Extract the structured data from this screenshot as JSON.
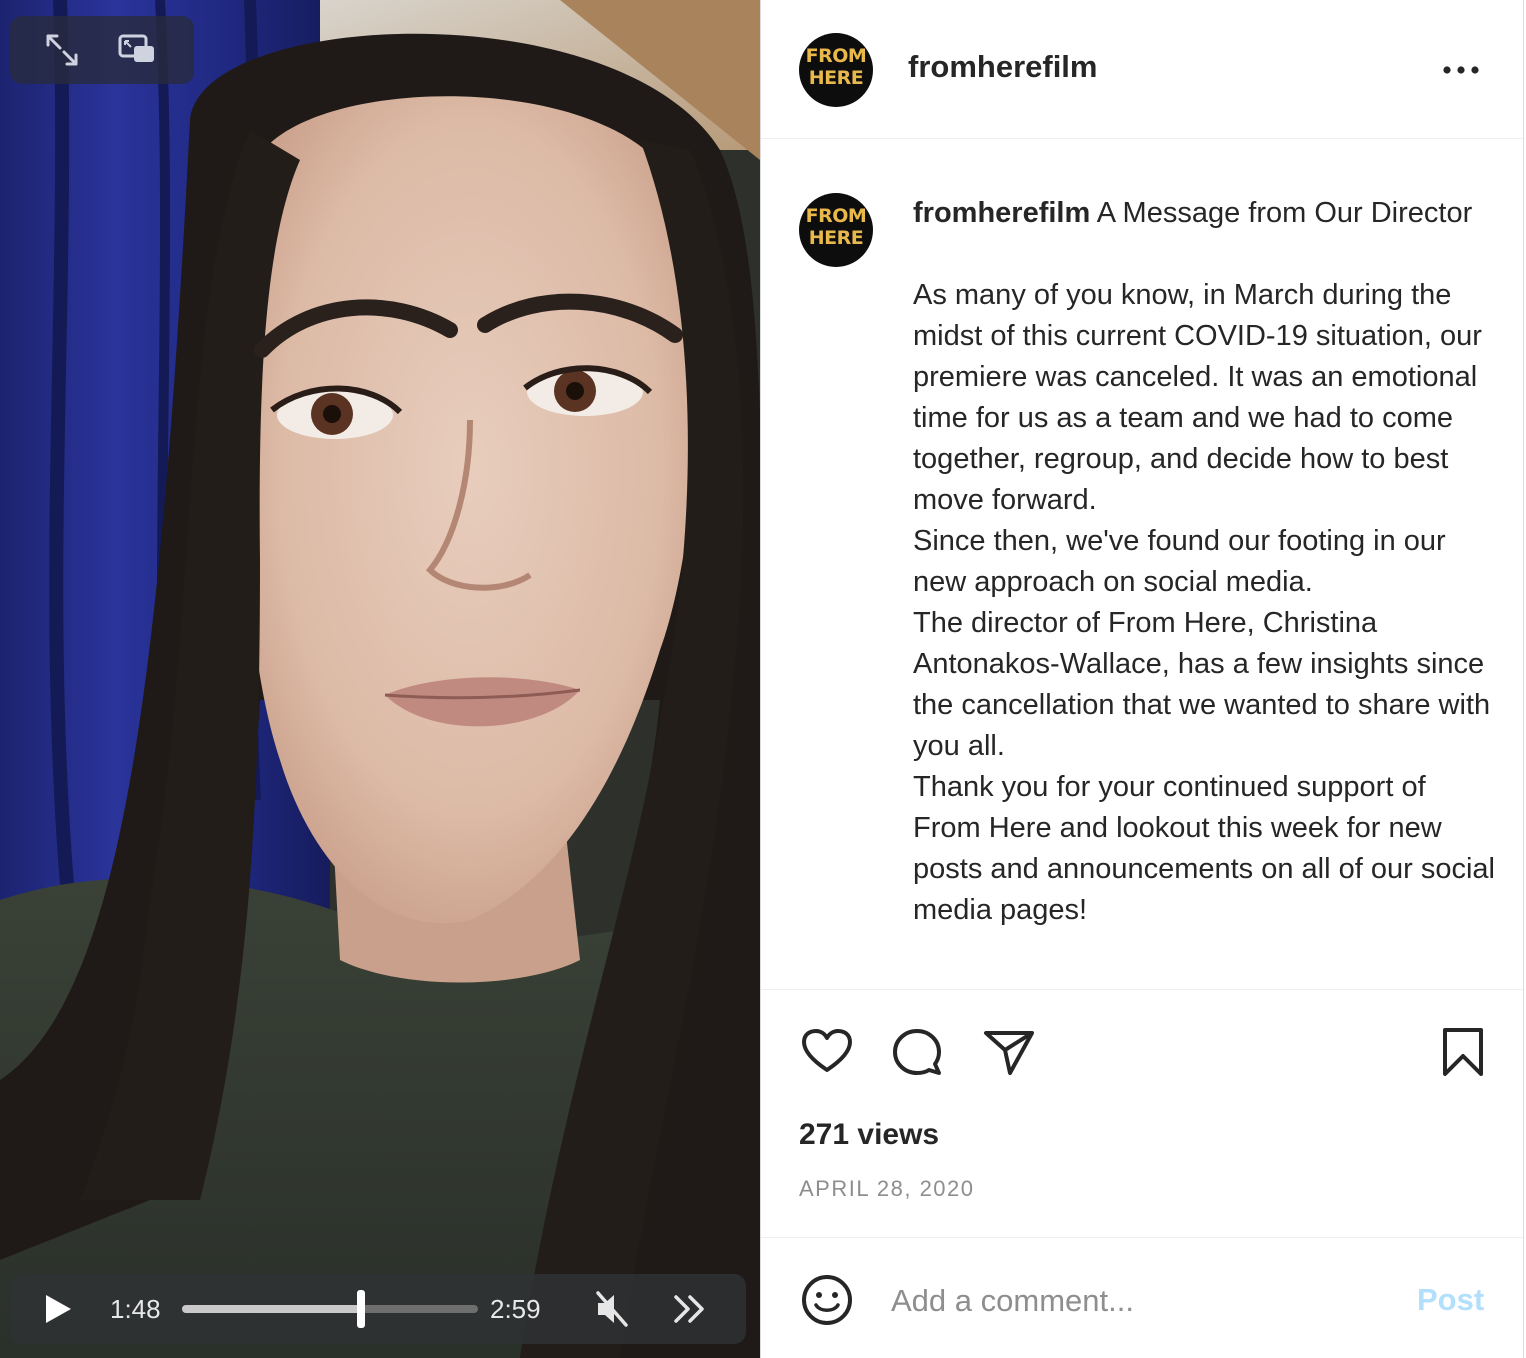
{
  "video": {
    "current_time": "1:48",
    "total_time": "2:59",
    "progress": 0.6034,
    "muted": true,
    "icons": {
      "expand": "expand-arrows-icon",
      "pip": "picture-in-picture-icon",
      "play": "play-icon",
      "mute": "muted-speaker-icon",
      "skip": "fast-forward-icon"
    }
  },
  "post": {
    "header": {
      "avatar_text": "FROM\nHERE",
      "username": "fromherefilm",
      "more_icon": "more-options-icon"
    },
    "caption": {
      "avatar_text": "FROM\nHERE",
      "username": "fromherefilm",
      "title": "A Message from Our Director",
      "body": "As many of you know, in March during the midst of this current COVID-19 situation, our premiere was canceled. It was an emotional time for us as a team and we had to come together, regroup, and decide how to best move forward.\nSince then, we've found our footing in our new approach on social media.\nThe director of From Here, Christina Antonakos-Wallace, has a few insights since the cancellation that we wanted to share with you all.\nThank you for your continued support of From Here and lookout this week for new posts and announcements on all of our social media pages!"
    },
    "actions": {
      "icons": [
        "heart-icon",
        "comment-icon",
        "share-icon",
        "bookmark-icon"
      ]
    },
    "views": "271 views",
    "date": "APRIL 28, 2020",
    "comment": {
      "placeholder": "Add a comment...",
      "post_label": "Post"
    },
    "colors": {
      "text": "#262626",
      "secondary": "#8e8e8e",
      "post_disabled": "#b2dffc",
      "avatar_gold": "#e8b84a"
    }
  }
}
